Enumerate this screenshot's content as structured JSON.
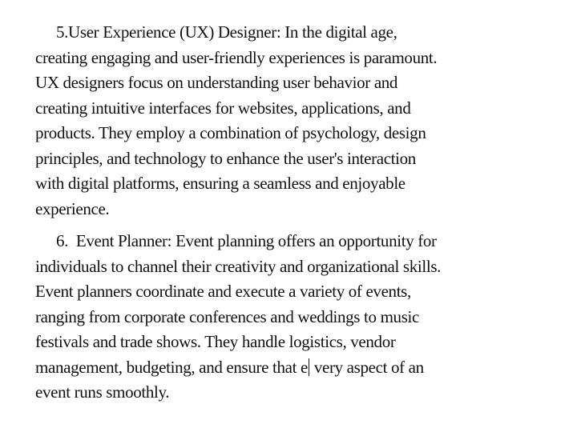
{
  "document": {
    "paragraphs": [
      {
        "lines": [
          "5.User Experience (UX) Designer: In the digital age,",
          "creating engaging and user-friendly experiences is paramount.",
          "UX designers focus on understanding user behavior and",
          "creating intuitive interfaces for websites, applications, and",
          "products. They employ a combination of psychology, design",
          "principles, and technology to enhance the user's interaction",
          "with digital platforms, ensuring a seamless and enjoyable",
          "experience."
        ]
      },
      {
        "lines": [
          "6.  Event Planner: Event planning offers an opportunity for",
          "individuals to channel their creativity and organizational skills.",
          "Event planners coordinate and execute a variety of events,",
          "ranging from corporate conferences and weddings to music",
          "festivals and trade shows. They handle logistics, vendor"
        ],
        "cursor_line_before": "management, budgeting, and ensure that e",
        "cursor_line_after": " very aspect of an",
        "last_line": "event runs smoothly."
      }
    ]
  }
}
